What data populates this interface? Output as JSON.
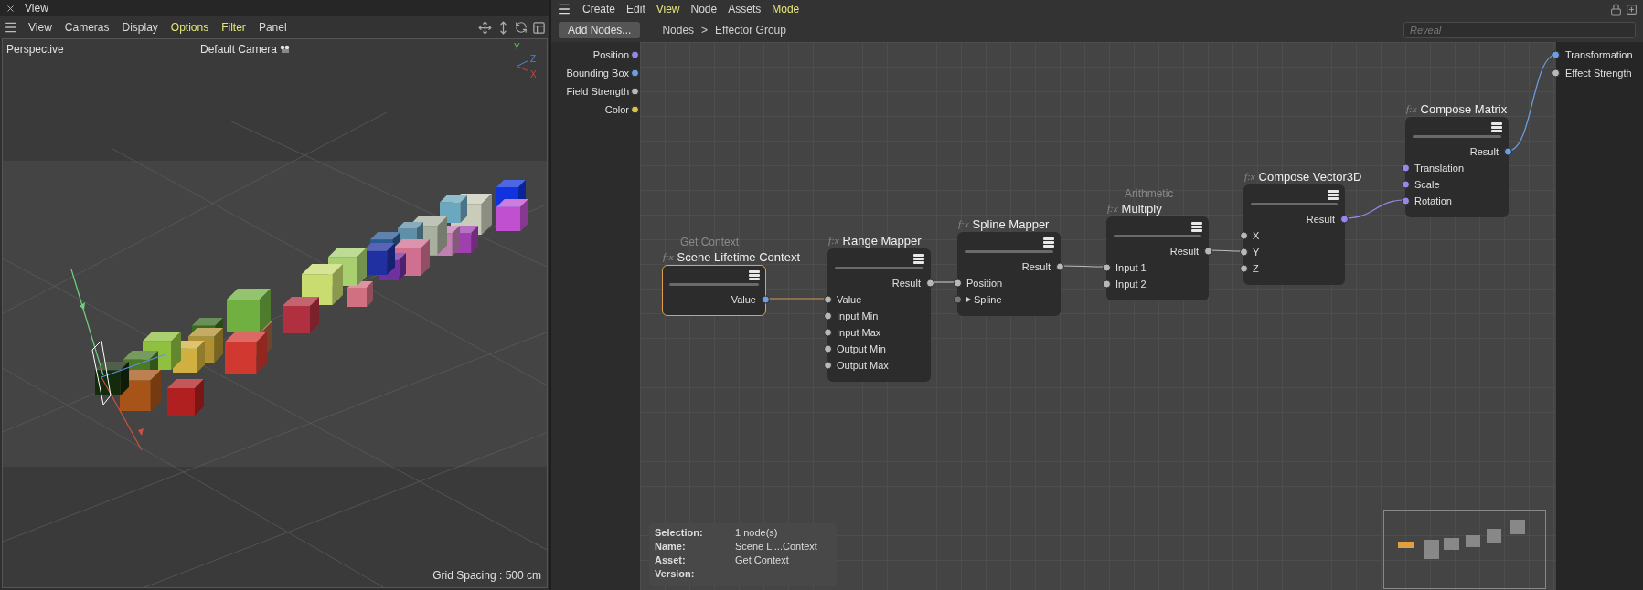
{
  "viewport_panel": {
    "title": "View",
    "menu": [
      {
        "label": "View",
        "highlighted": false
      },
      {
        "label": "Cameras",
        "highlighted": false
      },
      {
        "label": "Display",
        "highlighted": false
      },
      {
        "label": "Options",
        "highlighted": true
      },
      {
        "label": "Filter",
        "highlighted": true
      },
      {
        "label": "Panel",
        "highlighted": false
      }
    ],
    "camera_mode": "Perspective",
    "camera_name": "Default Camera",
    "axis_labels": [
      "Y",
      "Z",
      "X"
    ],
    "grid_spacing": "Grid Spacing : 500 cm"
  },
  "node_editor": {
    "menu": [
      {
        "label": "Create",
        "highlighted": false
      },
      {
        "label": "Edit",
        "highlighted": false
      },
      {
        "label": "View",
        "highlighted": true
      },
      {
        "label": "Node",
        "highlighted": false
      },
      {
        "label": "Assets",
        "highlighted": false
      },
      {
        "label": "Mode",
        "highlighted": true
      }
    ],
    "add_nodes_button": "Add Nodes...",
    "breadcrumb": [
      "Nodes",
      "Effector Group"
    ],
    "breadcrumb_separator": ">",
    "search": {
      "placeholder": "Reveal"
    },
    "group_inputs": [
      {
        "label": "Position",
        "color": "#9a86e8"
      },
      {
        "label": "Bounding Box",
        "color": "#6d9ee0"
      },
      {
        "label": "Field Strength",
        "color": "#b8b8b8"
      },
      {
        "label": "Color",
        "color": "#d9c24a"
      }
    ],
    "group_outputs": [
      {
        "label": "Transformation",
        "color": "#6d9ee0"
      },
      {
        "label": "Effect Strength",
        "color": "#b8b8b8"
      }
    ],
    "nodes": [
      {
        "icon_text": "f:x",
        "category": "Get Context",
        "title": "Scene Lifetime Context",
        "selected": true,
        "outputs": [
          {
            "label": "Value",
            "color": "#6d9ee0"
          }
        ]
      },
      {
        "icon_text": "f:x",
        "title": "Range Mapper",
        "selected": false,
        "outputs": [
          {
            "label": "Result",
            "color": "#b8b8b8"
          }
        ],
        "inputs": [
          {
            "label": "Value",
            "color": "#b8b8b8"
          },
          {
            "label": "Input Min",
            "color": "#b8b8b8"
          },
          {
            "label": "Input Max",
            "color": "#b8b8b8"
          },
          {
            "label": "Output Min",
            "color": "#b8b8b8"
          },
          {
            "label": "Output Max",
            "color": "#b8b8b8"
          }
        ]
      },
      {
        "icon_text": "f:x",
        "title": "Spline Mapper",
        "selected": false,
        "outputs": [
          {
            "label": "Result",
            "color": "#b8b8b8"
          }
        ],
        "inputs": [
          {
            "label": "Position",
            "color": "#b8b8b8"
          },
          {
            "label": "Spline",
            "color": "#777777",
            "expandable": true
          }
        ]
      },
      {
        "icon_text": "f:x",
        "category": "Arithmetic",
        "title": "Multiply",
        "selected": false,
        "outputs": [
          {
            "label": "Result",
            "color": "#b8b8b8"
          }
        ],
        "inputs": [
          {
            "label": "Input 1",
            "color": "#b8b8b8"
          },
          {
            "label": "Input 2",
            "color": "#b8b8b8"
          }
        ]
      },
      {
        "icon_text": "f:x",
        "title": "Compose Vector3D",
        "selected": false,
        "outputs": [
          {
            "label": "Result",
            "color": "#9a86e8"
          }
        ],
        "inputs": [
          {
            "label": "X",
            "color": "#b8b8b8"
          },
          {
            "label": "Y",
            "color": "#b8b8b8"
          },
          {
            "label": "Z",
            "color": "#b8b8b8"
          }
        ]
      },
      {
        "icon_text": "f:x",
        "title": "Compose Matrix",
        "selected": false,
        "outputs": [
          {
            "label": "Result",
            "color": "#6d9ee0"
          }
        ],
        "inputs": [
          {
            "label": "Translation",
            "color": "#9a86e8"
          },
          {
            "label": "Scale",
            "color": "#9a86e8"
          },
          {
            "label": "Rotation",
            "color": "#9a86e8"
          }
        ]
      }
    ],
    "info": [
      {
        "label": "Selection:",
        "value": "1 node(s)"
      },
      {
        "label": "Name:",
        "value": "Scene Li...Context"
      },
      {
        "label": "Asset:",
        "value": "Get Context"
      },
      {
        "label": "Version:"
      }
    ]
  }
}
